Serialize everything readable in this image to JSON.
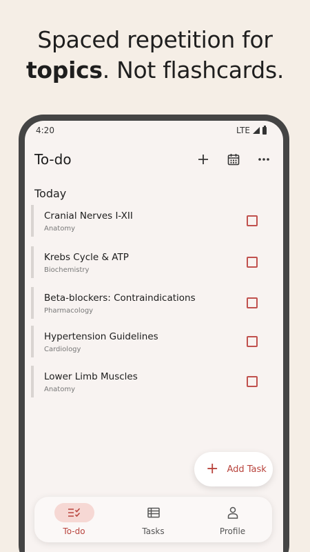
{
  "headline": {
    "line1": "Spaced repetition for",
    "bold": "topics",
    "rest": ". Not flashcards."
  },
  "status": {
    "time": "4:20",
    "network": "LTE"
  },
  "appbar": {
    "title": "To-do",
    "add_icon": "plus-icon",
    "calendar_icon": "calendar-icon",
    "more_icon": "more-horizontal-icon"
  },
  "section": {
    "title": "Today"
  },
  "tasks": [
    {
      "title": "Cranial Nerves I-XII",
      "subject": "Anatomy"
    },
    {
      "title": "Krebs Cycle & ATP",
      "subject": "Biochemistry"
    },
    {
      "title": "Beta-blockers: Contraindications",
      "subject": "Pharmacology"
    },
    {
      "title": "Hypertension Guidelines",
      "subject": "Cardiology"
    },
    {
      "title": "Lower Limb Muscles",
      "subject": "Anatomy"
    }
  ],
  "fab": {
    "label": "Add Task"
  },
  "nav": [
    {
      "label": "To-do",
      "icon": "checklist-icon",
      "active": true
    },
    {
      "label": "Tasks",
      "icon": "list-icon",
      "active": false
    },
    {
      "label": "Profile",
      "icon": "person-icon",
      "active": false
    }
  ],
  "colors": {
    "accent": "#b8433c",
    "background": "#f5eee6",
    "screen": "#f8f3f1",
    "active_pill": "#f6d8d4"
  }
}
